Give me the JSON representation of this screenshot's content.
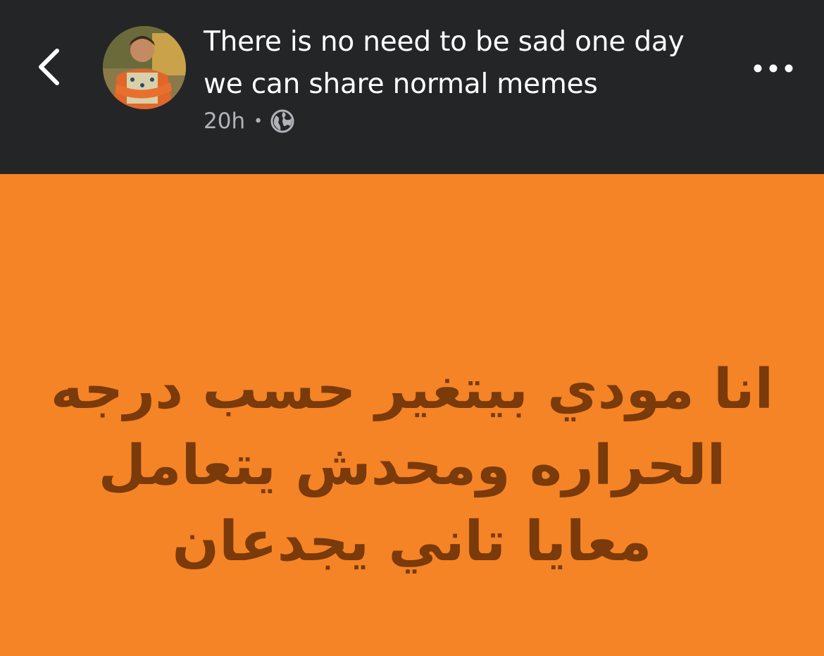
{
  "header": {
    "back_icon": "chevron-left-icon",
    "title": "There is no need to be sad one day we can share normal memes",
    "time": "20h",
    "separator": "•",
    "privacy_icon": "globe-icon",
    "more_icon": "more-horizontal-icon"
  },
  "post": {
    "background_color": "#f58426",
    "text_color": "#7a3a0a",
    "text": "انا مودي بيتغير حسب درجه الحراره ومحدش يتعامل معايا تاني يجدعان"
  }
}
